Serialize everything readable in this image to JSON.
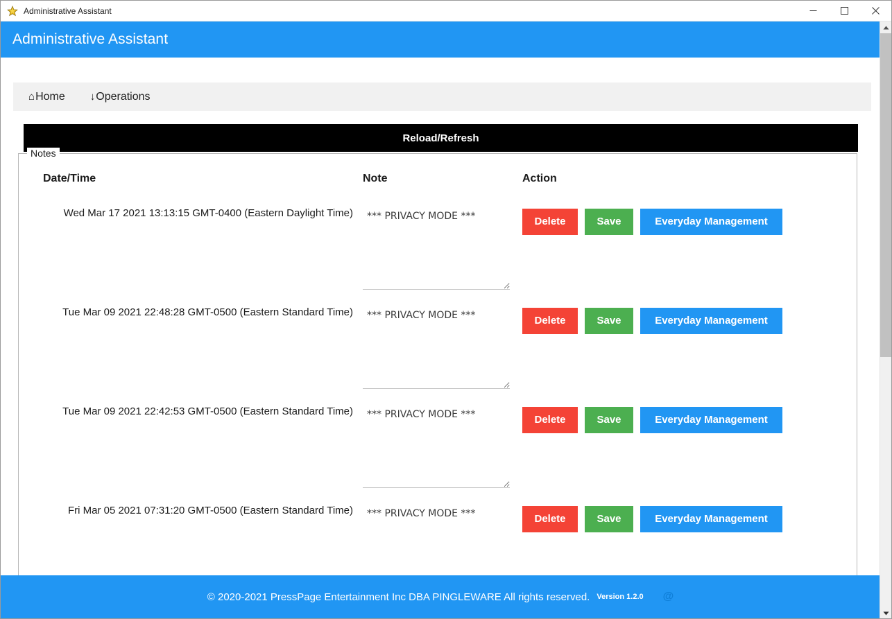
{
  "window": {
    "title": "Administrative Assistant",
    "icon": "star-app-icon",
    "controls": {
      "minimize": "minimize-icon",
      "maximize": "maximize-icon",
      "close": "close-icon"
    }
  },
  "header": {
    "title": "Administrative Assistant",
    "background": "#2196f3"
  },
  "nav": {
    "items": [
      {
        "icon": "⌂",
        "icon_name": "home-icon",
        "label": "Home"
      },
      {
        "icon": "↓",
        "icon_name": "download-arrow-icon",
        "label": "Operations"
      }
    ]
  },
  "toolbar": {
    "reload_label": "Reload/Refresh"
  },
  "notes_panel": {
    "legend": "Notes",
    "columns": [
      "Date/Time",
      "Note",
      "Action"
    ],
    "rows": [
      {
        "datetime": "Wed Mar 17 2021 13:13:15 GMT-0400 (Eastern Daylight Time)",
        "note": "*** PRIVACY MODE ***",
        "delete_label": "Delete",
        "save_label": "Save",
        "manage_label": "Everyday Management"
      },
      {
        "datetime": "Tue Mar 09 2021 22:48:28 GMT-0500 (Eastern Standard Time)",
        "note": "*** PRIVACY MODE ***",
        "delete_label": "Delete",
        "save_label": "Save",
        "manage_label": "Everyday Management"
      },
      {
        "datetime": "Tue Mar 09 2021 22:42:53 GMT-0500 (Eastern Standard Time)",
        "note": "*** PRIVACY MODE ***",
        "delete_label": "Delete",
        "save_label": "Save",
        "manage_label": "Everyday Management"
      },
      {
        "datetime": "Fri Mar 05 2021 07:31:20 GMT-0500 (Eastern Standard Time)",
        "note": "*** PRIVACY MODE ***",
        "delete_label": "Delete",
        "save_label": "Save",
        "manage_label": "Everyday Management"
      }
    ]
  },
  "footer": {
    "copyright": "© 2020-2021 PressPage Entertainment Inc DBA PINGLEWARE  All rights reserved.",
    "version": "Version 1.2.0",
    "email_icon": "@",
    "background": "#2196f3"
  },
  "colors": {
    "accent": "#2196f3",
    "delete": "#f44336",
    "save": "#4caf50",
    "manage": "#2196f3",
    "toolbar_bar": "#000000"
  }
}
